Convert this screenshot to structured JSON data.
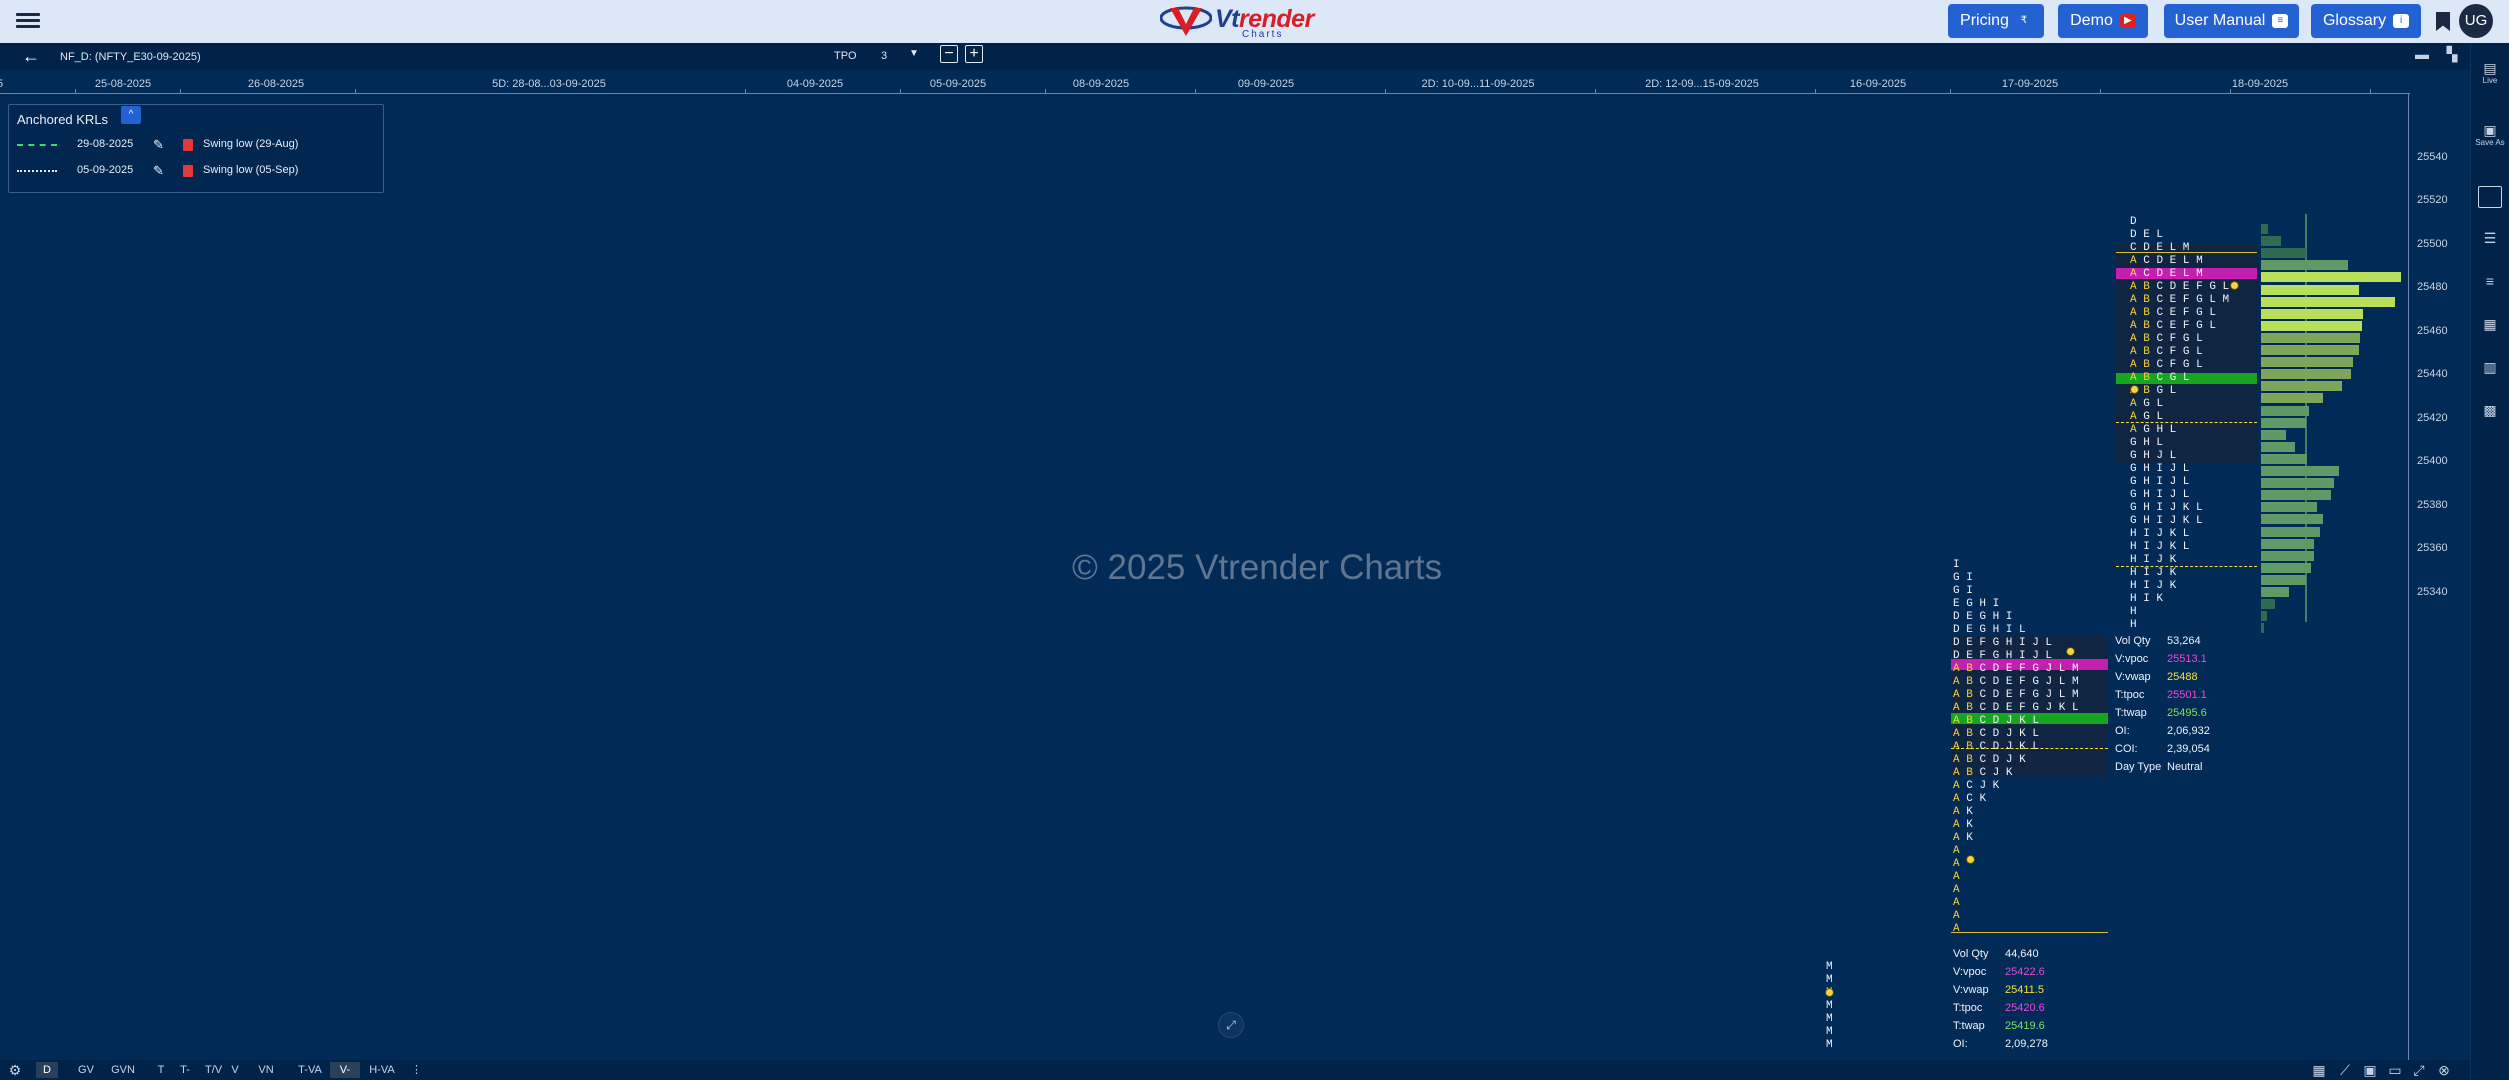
{
  "brand": {
    "word1": "Vt",
    "word2": "render",
    "sub": "Charts"
  },
  "nav": [
    {
      "label": "Pricing",
      "icon": "rupee-icon",
      "glyph": "₹"
    },
    {
      "label": "Demo",
      "icon": "youtube-icon",
      "glyph": "▶"
    },
    {
      "label": "User Manual",
      "icon": "manual-icon",
      "glyph": "≡"
    },
    {
      "label": "Glossary",
      "icon": "info-icon",
      "glyph": "i"
    }
  ],
  "user": {
    "initials": "UG"
  },
  "toolbar": {
    "symbol": "NF_D: (NFTY_E30-09-2025)",
    "tpo_label": "TPO",
    "tpo_value": "3",
    "minus": "−",
    "plus": "+"
  },
  "dates": [
    {
      "label": "5"
    },
    {
      "label": "25-08-2025"
    },
    {
      "label": "26-08-2025"
    },
    {
      "label": "5D: 28-08...03-09-2025"
    },
    {
      "label": "04-09-2025"
    },
    {
      "label": "05-09-2025"
    },
    {
      "label": "08-09-2025"
    },
    {
      "label": "09-09-2025"
    },
    {
      "label": "2D: 10-09...11-09-2025"
    },
    {
      "label": "2D: 12-09...15-09-2025"
    },
    {
      "label": "16-09-2025"
    },
    {
      "label": "17-09-2025"
    },
    {
      "label": "18-09-2025"
    }
  ],
  "prices": [
    "25540",
    "25520",
    "25500",
    "25480",
    "25460",
    "25440",
    "25420",
    "25400",
    "25380",
    "25360",
    "25340"
  ],
  "krl": {
    "title": "Anchored KRLs",
    "toggle": "^",
    "items": [
      {
        "date": "29-08-2025",
        "name": "Swing low (29-Aug)",
        "line": "#3ddc6a"
      },
      {
        "date": "05-09-2025",
        "name": "Swing low (05-Sep)",
        "line": "#e8eef7"
      }
    ]
  },
  "watermark": "© 2025 Vtrender Charts",
  "profile_17": {
    "rows": [
      {
        "text": "I"
      },
      {
        "text": "G I"
      },
      {
        "text": "G I"
      },
      {
        "text": "E G H I"
      },
      {
        "text": "D E G H I"
      },
      {
        "text": "D E G H I L"
      },
      {
        "text": "D E F G H I J L"
      },
      {
        "text": "D E F G H I J L"
      },
      {
        "text": "A B C D E F G J L M"
      },
      {
        "text": "A B C D E F G J L M"
      },
      {
        "text": "A B C D E F G J L M"
      },
      {
        "text": "A B C D E F G J K L"
      },
      {
        "text": "A B C D J K L"
      },
      {
        "text": "A B C D J K L"
      },
      {
        "text": "A B C D J K L"
      },
      {
        "text": "A B C D J K"
      },
      {
        "text": "A B C J K"
      },
      {
        "text": "A C J K"
      },
      {
        "text": "A C K"
      },
      {
        "text": "A K"
      },
      {
        "text": "A K"
      },
      {
        "text": "A K"
      },
      {
        "text": "A"
      },
      {
        "text": "A"
      },
      {
        "text": "A"
      },
      {
        "text": "A"
      },
      {
        "text": "A"
      },
      {
        "text": "A"
      },
      {
        "text": "A"
      }
    ],
    "stats": [
      {
        "k": "Vol Qty",
        "v": "53,264",
        "c": "#f0f4fa"
      },
      {
        "k": "V:vpoc",
        "v": "25513.1",
        "c": "#e84bd6"
      },
      {
        "k": "V:vwap",
        "v": "25488",
        "c": "#f5e23a"
      },
      {
        "k": "T:tpoc",
        "v": "25501.1",
        "c": "#e84bd6"
      },
      {
        "k": "T:twap",
        "v": "25495.6",
        "c": "#7ee05b"
      },
      {
        "k": "OI:",
        "v": "2,06,932",
        "c": "#f0f4fa"
      },
      {
        "k": "COI:",
        "v": "2,39,054",
        "c": "#f0f4fa"
      },
      {
        "k": "Day Type",
        "v": "Neutral",
        "c": "#f0f4fa"
      }
    ]
  },
  "profile_16": {
    "rows": [
      {
        "text": "M"
      },
      {
        "text": "M"
      },
      {
        "text": "M"
      },
      {
        "text": "M"
      },
      {
        "text": "M"
      },
      {
        "text": "M"
      },
      {
        "text": "M"
      }
    ],
    "stats": [
      {
        "k": "Vol Qty",
        "v": "44,640",
        "c": "#f0f4fa"
      },
      {
        "k": "V:vpoc",
        "v": "25422.6",
        "c": "#e84bd6"
      },
      {
        "k": "V:vwap",
        "v": "25411.5",
        "c": "#f5e23a"
      },
      {
        "k": "T:tpoc",
        "v": "25420.6",
        "c": "#e84bd6"
      },
      {
        "k": "T:twap",
        "v": "25419.6",
        "c": "#7ee05b"
      },
      {
        "k": "OI:",
        "v": "2,09,278",
        "c": "#f0f4fa"
      }
    ]
  },
  "profile_18": {
    "rows": [
      {
        "text": "D"
      },
      {
        "text": "D E L"
      },
      {
        "text": "C D E L M"
      },
      {
        "text": "A C D E L M"
      },
      {
        "text": "A C D E L M"
      },
      {
        "text": "A B C D E F G L"
      },
      {
        "text": "A B C E F G L M"
      },
      {
        "text": "A B C E F G L"
      },
      {
        "text": "A B C E F G L"
      },
      {
        "text": "A B C F G L"
      },
      {
        "text": "A B C F G L"
      },
      {
        "text": "A B C F G L"
      },
      {
        "text": "A B C G L"
      },
      {
        "text": "A B G L"
      },
      {
        "text": "A G L"
      },
      {
        "text": "A G L"
      },
      {
        "text": "A G H L"
      },
      {
        "text": "G H L"
      },
      {
        "text": "G H J L"
      },
      {
        "text": "G H I J L"
      },
      {
        "text": "G H I J L"
      },
      {
        "text": "G H I J L"
      },
      {
        "text": "G H I J K L"
      },
      {
        "text": "G H I J K L"
      },
      {
        "text": "H I J K L"
      },
      {
        "text": "H I J K L"
      },
      {
        "text": "H I J K"
      },
      {
        "text": "H I J K"
      },
      {
        "text": "H I J K"
      },
      {
        "text": "H I K"
      },
      {
        "text": "H"
      },
      {
        "text": "H"
      }
    ],
    "volume": [
      0.05,
      0.14,
      0.32,
      0.62,
      1.0,
      0.7,
      0.96,
      0.73,
      0.72,
      0.71,
      0.7,
      0.66,
      0.64,
      0.58,
      0.44,
      0.34,
      0.32,
      0.18,
      0.24,
      0.33,
      0.56,
      0.52,
      0.5,
      0.4,
      0.44,
      0.42,
      0.38,
      0.38,
      0.36,
      0.32,
      0.2,
      0.1,
      0.04,
      0.02
    ]
  },
  "bottom": {
    "tabs": [
      "D",
      "GV",
      "GVN",
      "T",
      "T-V",
      "T/V",
      "V",
      "VN",
      "T-VA",
      "V-VA",
      "H-VA"
    ],
    "active": [
      "D",
      "V-VA"
    ],
    "more": "⋮"
  },
  "side": [
    {
      "glyph": "▤",
      "label": "Live"
    },
    {
      "glyph": "▣",
      "label": "Save As"
    }
  ]
}
